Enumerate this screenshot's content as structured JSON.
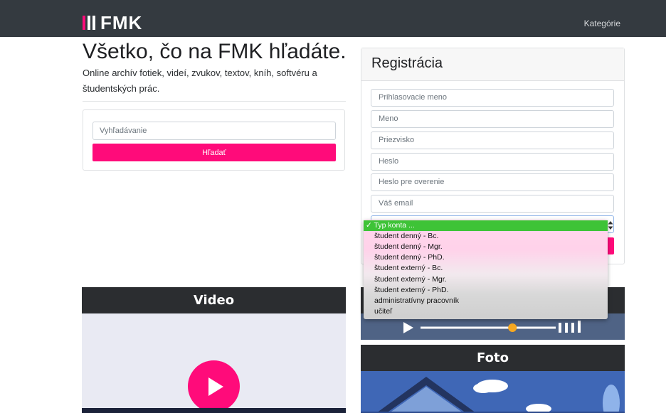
{
  "brand": {
    "logo_text": "FMK"
  },
  "nav": {
    "category_link": "Kategórie"
  },
  "hero": {
    "title": "Všetko, čo na FMK hľadáte.",
    "subtitle": "Online archív fotiek, videí, zvukov, textov, kníh, softvéru a študentských prác."
  },
  "search": {
    "placeholder": "Vyhľadávanie",
    "button_label": "Hľadať"
  },
  "registration": {
    "title": "Registrácia",
    "fields": [
      {
        "placeholder": "Prihlasovacie meno"
      },
      {
        "placeholder": "Meno"
      },
      {
        "placeholder": "Priezvisko"
      },
      {
        "placeholder": "Heslo"
      },
      {
        "placeholder": "Heslo pre overenie"
      },
      {
        "placeholder": "Váš email"
      }
    ],
    "account_type": {
      "selected": "Typ konta ...",
      "options": [
        "Typ konta ...",
        "študent denný - Bc.",
        "študent denný - Mgr.",
        "študent denný - PhD.",
        "študent externý - Bc.",
        "študent externý - Mgr.",
        "študent externý - PhD.",
        "administratívny pracovník",
        "učiteľ"
      ]
    }
  },
  "sections": {
    "video_title": "Video",
    "photo_title": "Foto"
  },
  "colors": {
    "accent": "#ff0b7a",
    "navbar": "#343a40",
    "card_header": "#2b2d30",
    "selected_option": "#3ec337",
    "audio_bg": "#4f6385",
    "photo_bg": "#3f67b6"
  },
  "audio_player": {
    "progress": 0.68
  }
}
